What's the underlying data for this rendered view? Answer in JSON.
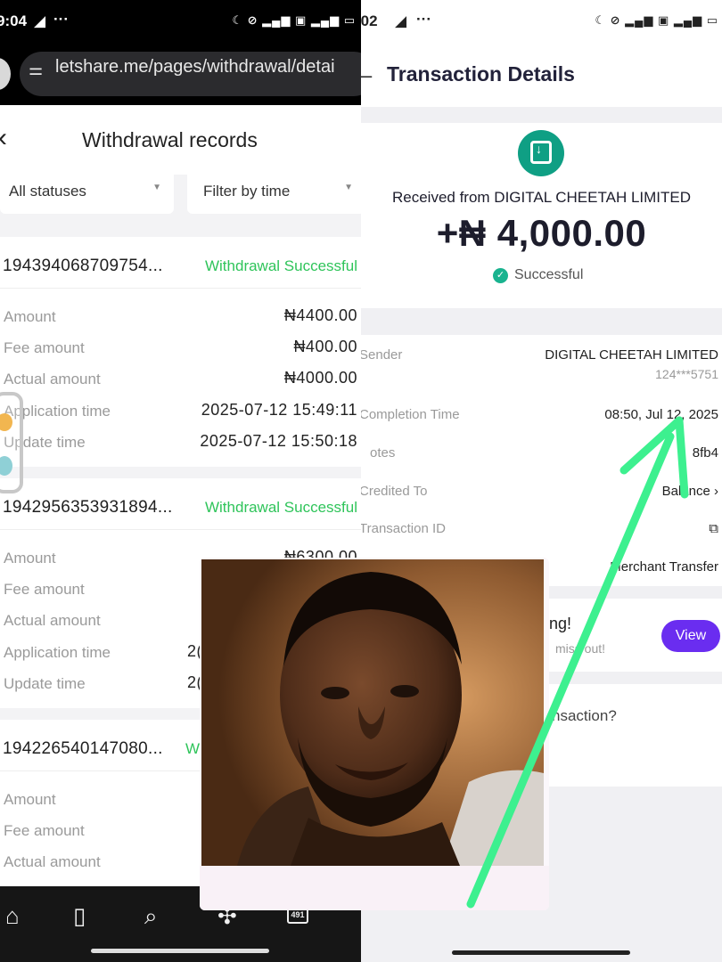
{
  "left": {
    "status_time": "9:04",
    "url": "letshare.me/pages/withdrawal/detai",
    "page_title": "Withdrawal records",
    "filters": {
      "status": "All statuses",
      "time": "Filter by time"
    },
    "records": [
      {
        "id": "194394068709754...",
        "status": "Withdrawal Successful",
        "rows": [
          {
            "label": "Amount",
            "value": "₦4400.00"
          },
          {
            "label": "Fee amount",
            "value": "₦400.00"
          },
          {
            "label": "Actual amount",
            "value": "₦4000.00"
          },
          {
            "label": "Application time",
            "value": "2025-07-12 15:49:11"
          },
          {
            "label": "Update time",
            "value": "2025-07-12 15:50:18"
          }
        ]
      },
      {
        "id": "1942956353931894...",
        "status": "Withdrawal Successful",
        "rows": [
          {
            "label": "Amount",
            "value": "₦6300.00"
          },
          {
            "label": "Fee amount",
            "value": ""
          },
          {
            "label": "Actual amount",
            "value": ""
          },
          {
            "label": "Application time",
            "value": "2("
          },
          {
            "label": "Update time",
            "value": "2("
          }
        ]
      },
      {
        "id": "194226540147080...",
        "status": "W",
        "rows": [
          {
            "label": "Amount",
            "value": ""
          },
          {
            "label": "Fee amount",
            "value": ""
          },
          {
            "label": "Actual amount",
            "value": ""
          }
        ]
      }
    ],
    "tab_count": "491"
  },
  "right": {
    "status_time": ":02",
    "page_title": "Transaction Details",
    "received_from": "Received from DIGITAL CHEETAH LIMITED",
    "amount": "+₦ 4,000.00",
    "status": "Successful",
    "details": [
      {
        "label": "Sender",
        "value": "DIGITAL CHEETAH LIMITED",
        "sub": "124***5751"
      },
      {
        "label": "Completion Time",
        "value": "08:50, Jul 12, 2025"
      },
      {
        "label": "otes",
        "value": "8fb4"
      },
      {
        "label": "Credited To",
        "value": "Balance ›"
      },
      {
        "label": "Transaction ID",
        "value": "⧉"
      },
      {
        "label": "",
        "value": "Merchant Transfer"
      }
    ],
    "promo_title": "iting!",
    "promo_sub": "miss out!",
    "view_label": "View",
    "help_text": "nsaction?"
  },
  "colors": {
    "success_green": "#2fc45a",
    "brand_teal": "#0f9f84",
    "view_purple": "#6a2df0",
    "arrow_green": "#3df08f"
  },
  "icons": [
    "telegram-icon",
    "home-icon",
    "bookmark-icon",
    "search-icon",
    "extension-icon",
    "tabs-icon",
    "back-icon",
    "download-box-icon",
    "check-icon",
    "copy-icon"
  ]
}
